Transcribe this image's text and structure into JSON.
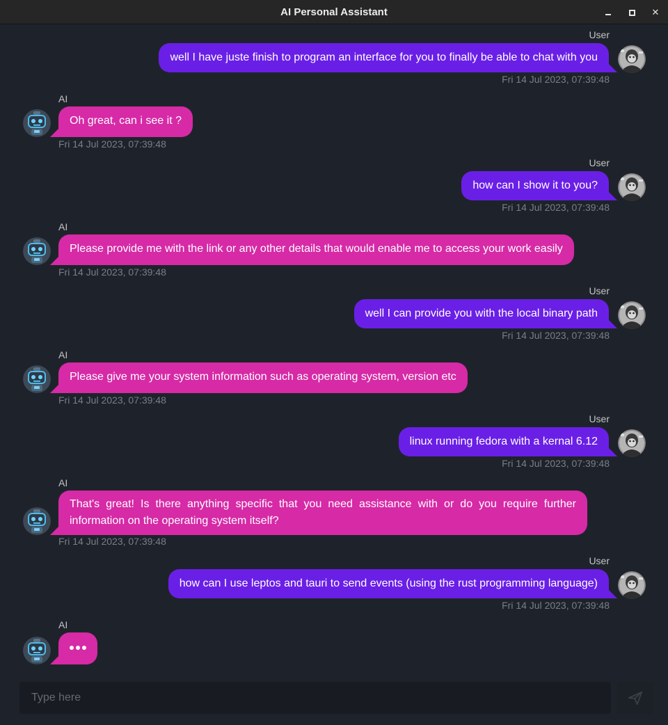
{
  "window": {
    "title": "AI Personal Assistant"
  },
  "messages": [
    {
      "role": "user",
      "sender": "User",
      "text": "well I have juste finish to program an interface for you to finally be able to chat with you",
      "time": "Fri 14 Jul 2023, 07:39:48"
    },
    {
      "role": "ai",
      "sender": "AI",
      "text": "Oh great, can i see it ?",
      "time": "Fri 14 Jul 2023, 07:39:48"
    },
    {
      "role": "user",
      "sender": "User",
      "text": "how can I show it to you?",
      "time": "Fri 14 Jul 2023, 07:39:48"
    },
    {
      "role": "ai",
      "sender": "AI",
      "text": "Please provide me with the link or any other details that would enable me to access your work easily",
      "time": "Fri 14 Jul 2023, 07:39:48"
    },
    {
      "role": "user",
      "sender": "User",
      "text": "well I can provide you with the local binary path",
      "time": "Fri 14 Jul 2023, 07:39:48"
    },
    {
      "role": "ai",
      "sender": "AI",
      "text": "Please give me your system information such as operating system, version etc",
      "time": "Fri 14 Jul 2023, 07:39:48"
    },
    {
      "role": "user",
      "sender": "User",
      "text": "linux running fedora with a kernal 6.12",
      "time": "Fri 14 Jul 2023, 07:39:48"
    },
    {
      "role": "ai",
      "sender": "AI",
      "text": "That's great! Is there anything specific that you need assistance with or do you require further information on the operating system itself?",
      "time": "Fri 14 Jul 2023, 07:39:48"
    },
    {
      "role": "user",
      "sender": "User",
      "text": "how can I use leptos and tauri to send events (using the rust programming language)",
      "time": "Fri 14 Jul 2023, 07:39:48"
    }
  ],
  "typing": {
    "sender": "AI"
  },
  "composer": {
    "placeholder": "Type here",
    "send_icon": "send-icon"
  },
  "colors": {
    "background": "#1e232b",
    "user_bubble": "#6a1fe6",
    "ai_bubble": "#d62aa6"
  }
}
